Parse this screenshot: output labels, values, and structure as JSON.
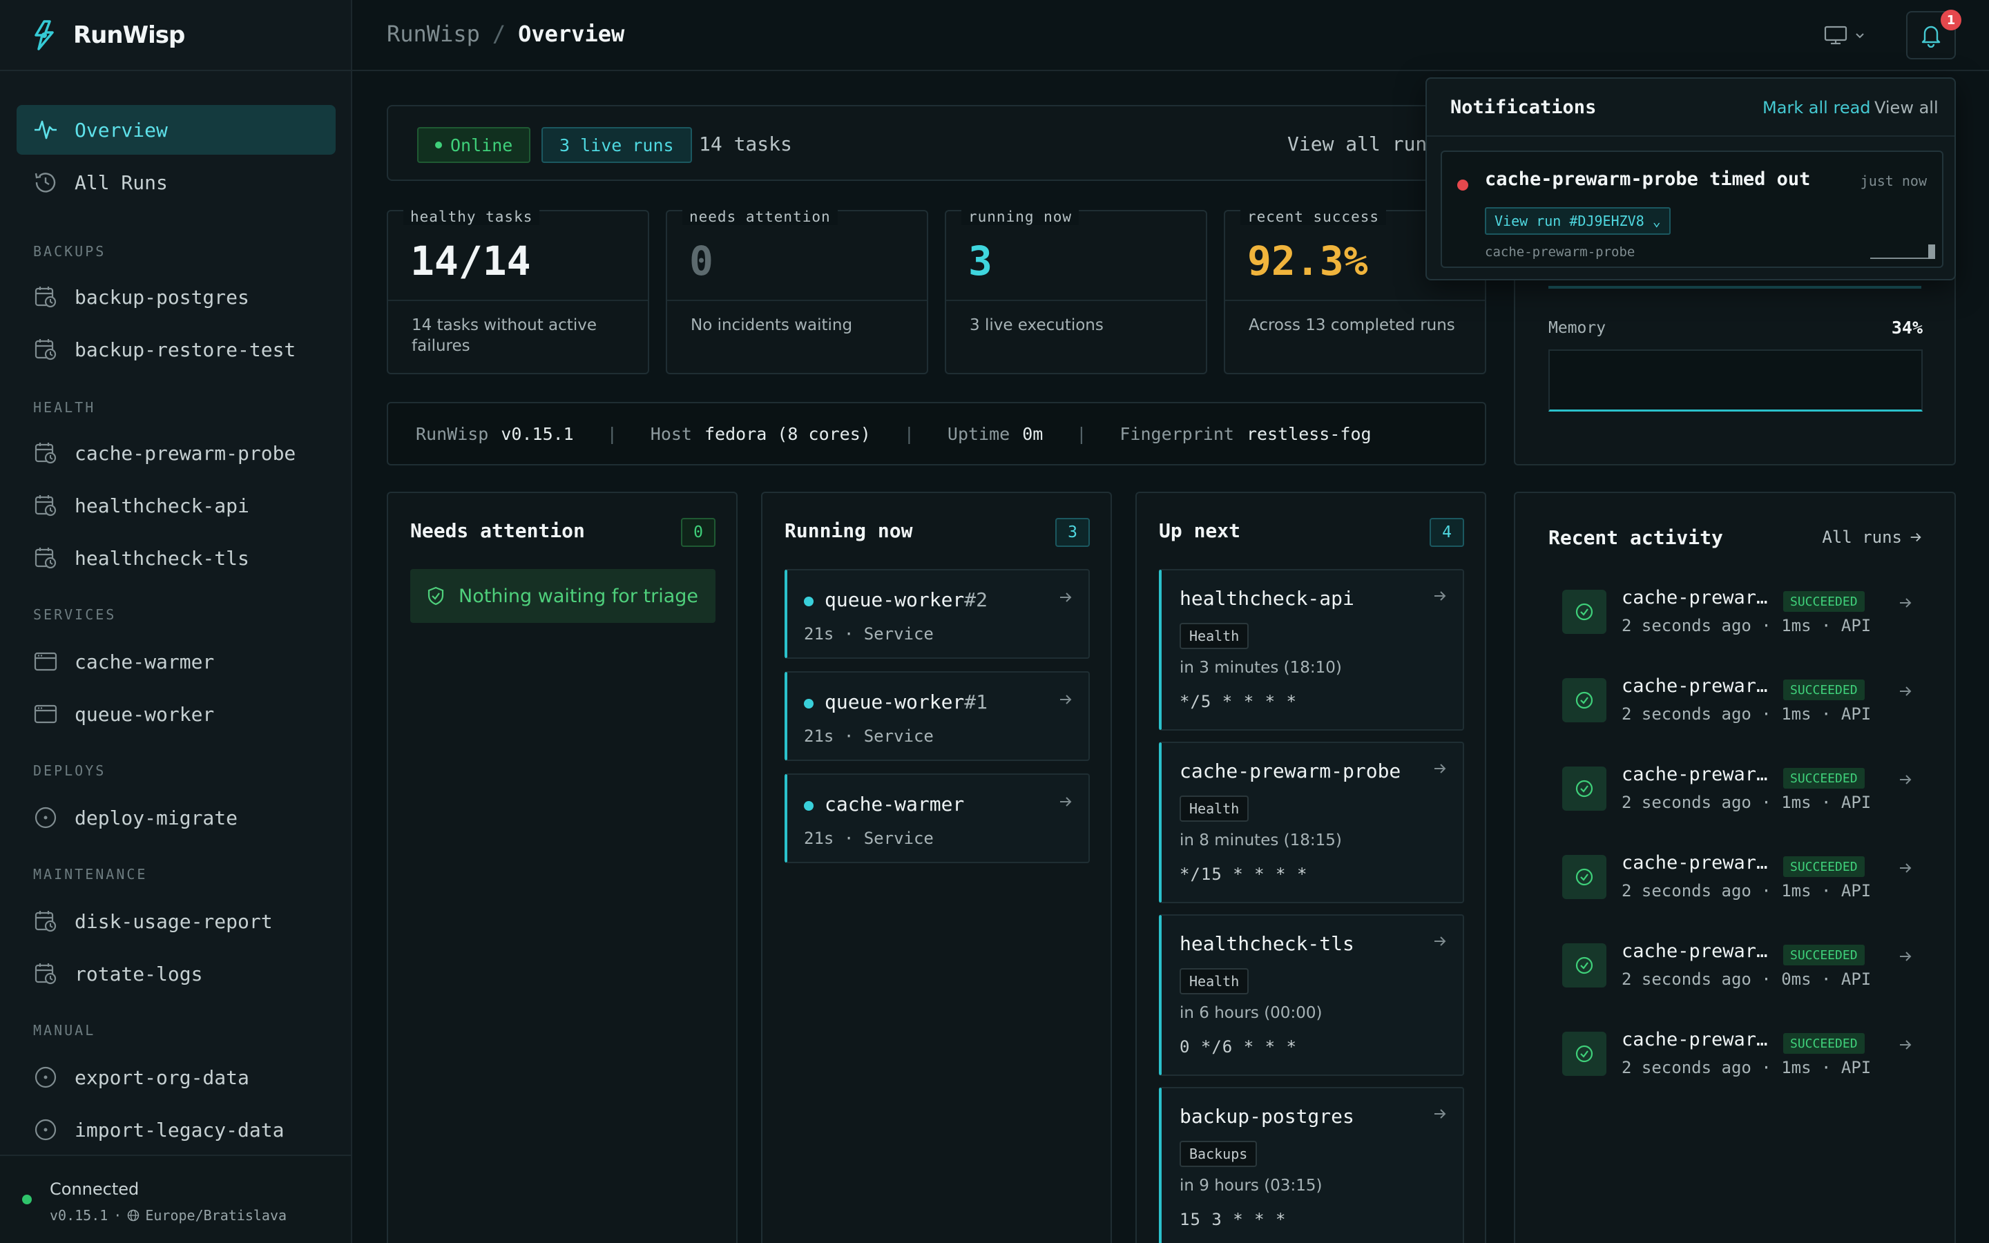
{
  "app": {
    "name": "RunWisp"
  },
  "breadcrumb": {
    "root": "RunWisp",
    "separator": "/",
    "current": "Overview"
  },
  "sidebar": {
    "primary": [
      {
        "label": "Overview",
        "icon": "activity-icon",
        "active": true
      },
      {
        "label": "All Runs",
        "icon": "history-icon",
        "active": false
      }
    ],
    "sections": [
      {
        "title": "BACKUPS",
        "items": [
          {
            "label": "backup-postgres",
            "icon": "calendar-clock-icon"
          },
          {
            "label": "backup-restore-test",
            "icon": "calendar-clock-icon"
          }
        ]
      },
      {
        "title": "HEALTH",
        "items": [
          {
            "label": "cache-prewarm-probe",
            "icon": "calendar-clock-icon"
          },
          {
            "label": "healthcheck-api",
            "icon": "calendar-clock-icon"
          },
          {
            "label": "healthcheck-tls",
            "icon": "calendar-clock-icon"
          }
        ]
      },
      {
        "title": "SERVICES",
        "items": [
          {
            "label": "cache-warmer",
            "icon": "window-icon"
          },
          {
            "label": "queue-worker",
            "icon": "window-icon"
          }
        ]
      },
      {
        "title": "DEPLOYS",
        "items": [
          {
            "label": "deploy-migrate",
            "icon": "circle-dot-icon"
          }
        ]
      },
      {
        "title": "MAINTENANCE",
        "items": [
          {
            "label": "disk-usage-report",
            "icon": "calendar-clock-icon"
          },
          {
            "label": "rotate-logs",
            "icon": "calendar-clock-icon"
          }
        ]
      },
      {
        "title": "MANUAL",
        "items": [
          {
            "label": "export-org-data",
            "icon": "circle-dot-icon"
          },
          {
            "label": "import-legacy-data",
            "icon": "circle-dot-icon"
          }
        ]
      }
    ],
    "footer": {
      "status": "Connected",
      "version": "v0.15.1",
      "separator": "·",
      "timezone": "Europe/Bratislava"
    }
  },
  "header": {
    "notification_count": "1"
  },
  "status_strip": {
    "online": "Online",
    "live_runs": "3 live runs",
    "tasks": "14 tasks",
    "view_all": "View all runs"
  },
  "stats": [
    {
      "label": "healthy tasks",
      "value": "14/14",
      "desc": "14 tasks without active failures",
      "color": "#f1f5f6"
    },
    {
      "label": "needs attention",
      "value": "0",
      "desc": "No incidents waiting",
      "color": "#5c6a6e"
    },
    {
      "label": "running now",
      "value": "3",
      "desc": "3 live executions",
      "color": "#3fd6de"
    },
    {
      "label": "recent success",
      "value": "92.3%",
      "desc": "Across 13 completed runs",
      "color": "#f0b43c"
    }
  ],
  "info": {
    "app_label": "RunWisp",
    "version": "v0.15.1",
    "host_label": "Host",
    "host": "fedora (8 cores)",
    "uptime_label": "Uptime",
    "uptime": "0m",
    "fingerprint_label": "Fingerprint",
    "fingerprint": "restless-fog",
    "separator": "|"
  },
  "needs_attention": {
    "title": "Needs attention",
    "count": "0",
    "empty": "Nothing waiting for triage"
  },
  "running_now": {
    "title": "Running now",
    "count": "3",
    "items": [
      {
        "name": "queue-worker",
        "suffix": "#2",
        "duration": "21s",
        "kind": "Service",
        "dot": "·"
      },
      {
        "name": "queue-worker",
        "suffix": "#1",
        "duration": "21s",
        "kind": "Service",
        "dot": "·"
      },
      {
        "name": "cache-warmer",
        "suffix": "",
        "duration": "21s",
        "kind": "Service",
        "dot": "·"
      }
    ]
  },
  "up_next": {
    "title": "Up next",
    "count": "4",
    "items": [
      {
        "name": "healthcheck-api",
        "tag": "Health",
        "when": "in 3 minutes (18:10)",
        "cron": "*/5 * * * *"
      },
      {
        "name": "cache-prewarm-probe",
        "tag": "Health",
        "when": "in 8 minutes (18:15)",
        "cron": "*/15 * * * *"
      },
      {
        "name": "healthcheck-tls",
        "tag": "Health",
        "when": "in 6 hours (00:00)",
        "cron": "0 */6 * * *"
      },
      {
        "name": "backup-postgres",
        "tag": "Backups",
        "when": "in 9 hours (03:15)",
        "cron": "15 3 * * *"
      }
    ]
  },
  "system": {
    "memory_label": "Memory",
    "memory_value": "34%",
    "memory_fraction": 0.34
  },
  "activity": {
    "title": "Recent activity",
    "all_runs": "All runs",
    "items": [
      {
        "name": "cache-prewarm-probe",
        "status": "SUCCEEDED",
        "sub": "2 seconds ago · 1ms · API"
      },
      {
        "name": "cache-prewarm-probe",
        "status": "SUCCEEDED",
        "sub": "2 seconds ago · 1ms · API"
      },
      {
        "name": "cache-prewarm-probe",
        "status": "SUCCEEDED",
        "sub": "2 seconds ago · 1ms · API"
      },
      {
        "name": "cache-prewarm-probe",
        "status": "SUCCEEDED",
        "sub": "2 seconds ago · 1ms · API"
      },
      {
        "name": "cache-prewarm-probe",
        "status": "SUCCEEDED",
        "sub": "2 seconds ago · 0ms · API"
      },
      {
        "name": "cache-prewarm-probe",
        "status": "SUCCEEDED",
        "sub": "2 seconds ago · 1ms · API"
      }
    ]
  },
  "notifications": {
    "title": "Notifications",
    "mark_all": "Mark all read",
    "view_all": "View all",
    "item": {
      "message": "cache-prewarm-probe timed out",
      "time": "just now",
      "action": "View run #DJ9EHZV8 ⌄",
      "source": "cache-prewarm-probe"
    }
  },
  "colors": {
    "accent": "#2bc1cb",
    "success": "#3fd07a",
    "danger": "#e5484d",
    "warning": "#f0b43c"
  }
}
